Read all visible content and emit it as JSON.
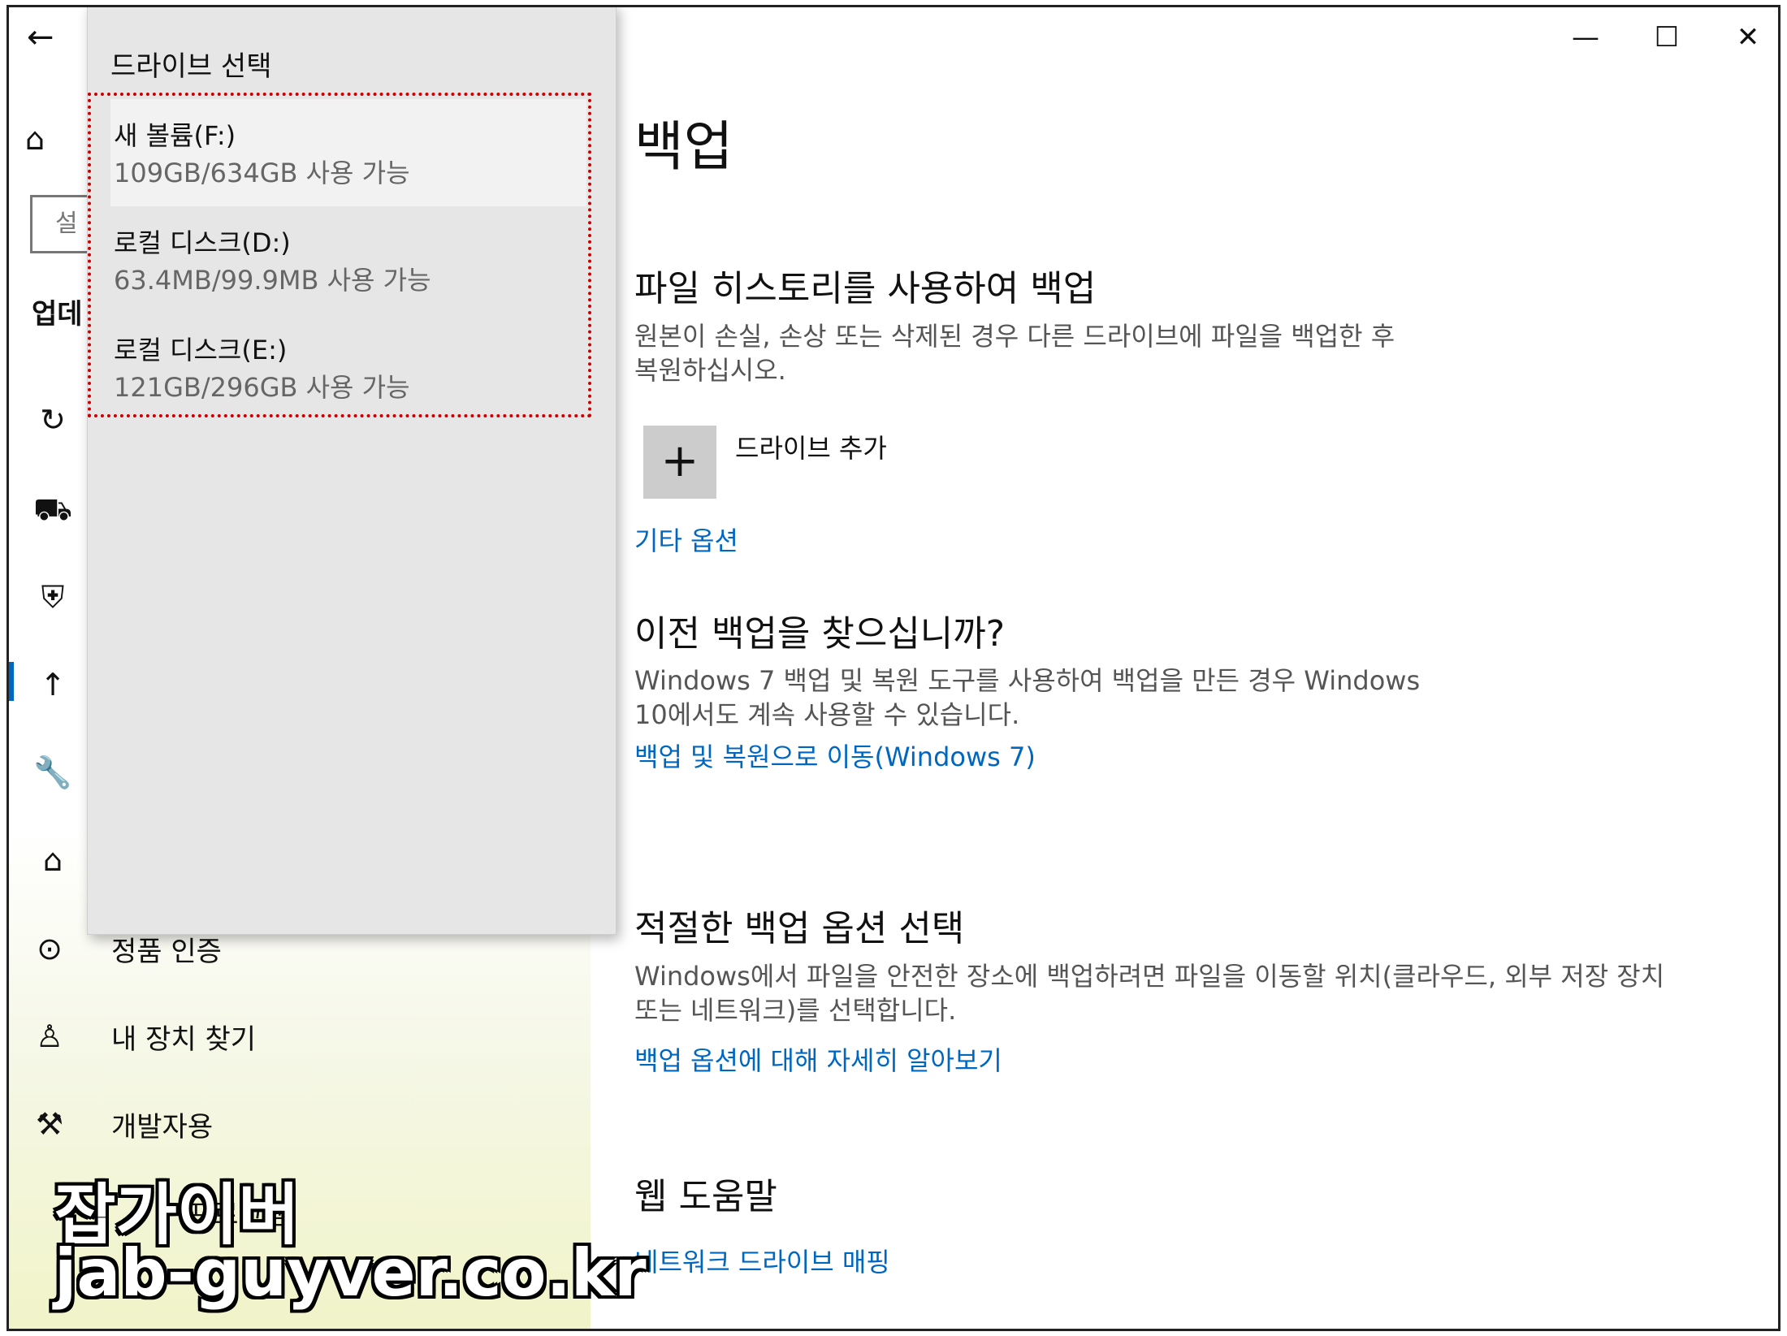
{
  "window": {
    "controls": {
      "minimize": "—",
      "maximize": "☐",
      "close": "✕"
    }
  },
  "nav": {
    "back": "←",
    "home": "⌂",
    "search_peek": "설",
    "section_peek": "업데",
    "icons": [
      "↻",
      "⛟",
      "⛨",
      "↑",
      "🔧",
      "⌂"
    ],
    "items": [
      {
        "icon": "⊙",
        "label": "정품 인증"
      },
      {
        "icon": "♙",
        "label": "내 장치 찾기"
      },
      {
        "icon": "⚒",
        "label": "개발자용"
      },
      {
        "icon": "☺",
        "label": "프로그램"
      }
    ]
  },
  "flyout": {
    "title": "드라이브 선택",
    "drives": [
      {
        "name": "새 볼륨(F:)",
        "space": "109GB/634GB 사용 가능"
      },
      {
        "name": "로컬 디스크(D:)",
        "space": "63.4MB/99.9MB 사용 가능"
      },
      {
        "name": "로컬 디스크(E:)",
        "space": "121GB/296GB 사용 가능"
      }
    ]
  },
  "main": {
    "title": "백업",
    "file_history": {
      "heading": "파일 히스토리를 사용하여 백업",
      "desc_line1": "원본이 손실, 손상 또는 삭제된 경우 다른 드라이브에 파일을 백업한 후",
      "desc_line2": "복원하십시오.",
      "add_icon": "+",
      "add_label": "드라이브 추가",
      "more_options": "기타 옵션"
    },
    "previous": {
      "heading": "이전 백업을 찾으십니까?",
      "desc_line1": "Windows 7 백업 및 복원 도구를 사용하여 백업을 만든 경우 Windows",
      "desc_line2": "10에서도 계속 사용할 수 있습니다.",
      "link": "백업 및 복원으로 이동(Windows 7)"
    },
    "choose": {
      "heading": "적절한 백업 옵션 선택",
      "desc_line1": "Windows에서 파일을 안전한 장소에 백업하려면 파일을 이동할 위치(클라우드, 외부 저장 장치",
      "desc_line2": "또는 네트워크)를 선택합니다.",
      "link": "백업 옵션에 대해 자세히 알아보기"
    },
    "web_help": {
      "heading": "웹 도움말",
      "link": "네트워크 드라이브 매핑"
    }
  },
  "watermark": {
    "line1": "잡가이버",
    "line2": "jab-guyver.co.kr"
  }
}
